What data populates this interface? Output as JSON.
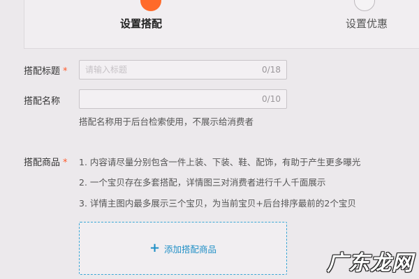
{
  "steps": [
    {
      "label": "设置搭配",
      "state": "active"
    },
    {
      "label": "设置优惠",
      "state": "inactive"
    }
  ],
  "form": {
    "title_field": {
      "label": "搭配标题",
      "required_mark": "*",
      "placeholder": "请输入标题",
      "value": "",
      "counter": "0/18"
    },
    "name_field": {
      "label": "搭配名称",
      "placeholder": "",
      "value": "",
      "counter": "0/10",
      "hint": "搭配名称用于后台检索使用，不展示给消费者"
    },
    "products_field": {
      "label": "搭配商品",
      "required_mark": "*",
      "rules": [
        "1. 内容请尽量分别包含一件上装、下装、鞋、配饰，有助于产生更多曝光",
        "2. 一个宝贝存在多套搭配，详情图三对消费者进行千人千面展示",
        "3. 详情主图内最多展示三个宝贝，为当前宝贝+后台排序最前的2个宝贝"
      ],
      "add_button": {
        "icon": "plus-icon",
        "label": "添加搭配商品"
      }
    }
  },
  "watermark": "广东龙网",
  "colors": {
    "accent_orange": "#ff6a2a",
    "link_blue": "#1f8fc6",
    "dashed_border": "#3aa7d6"
  }
}
